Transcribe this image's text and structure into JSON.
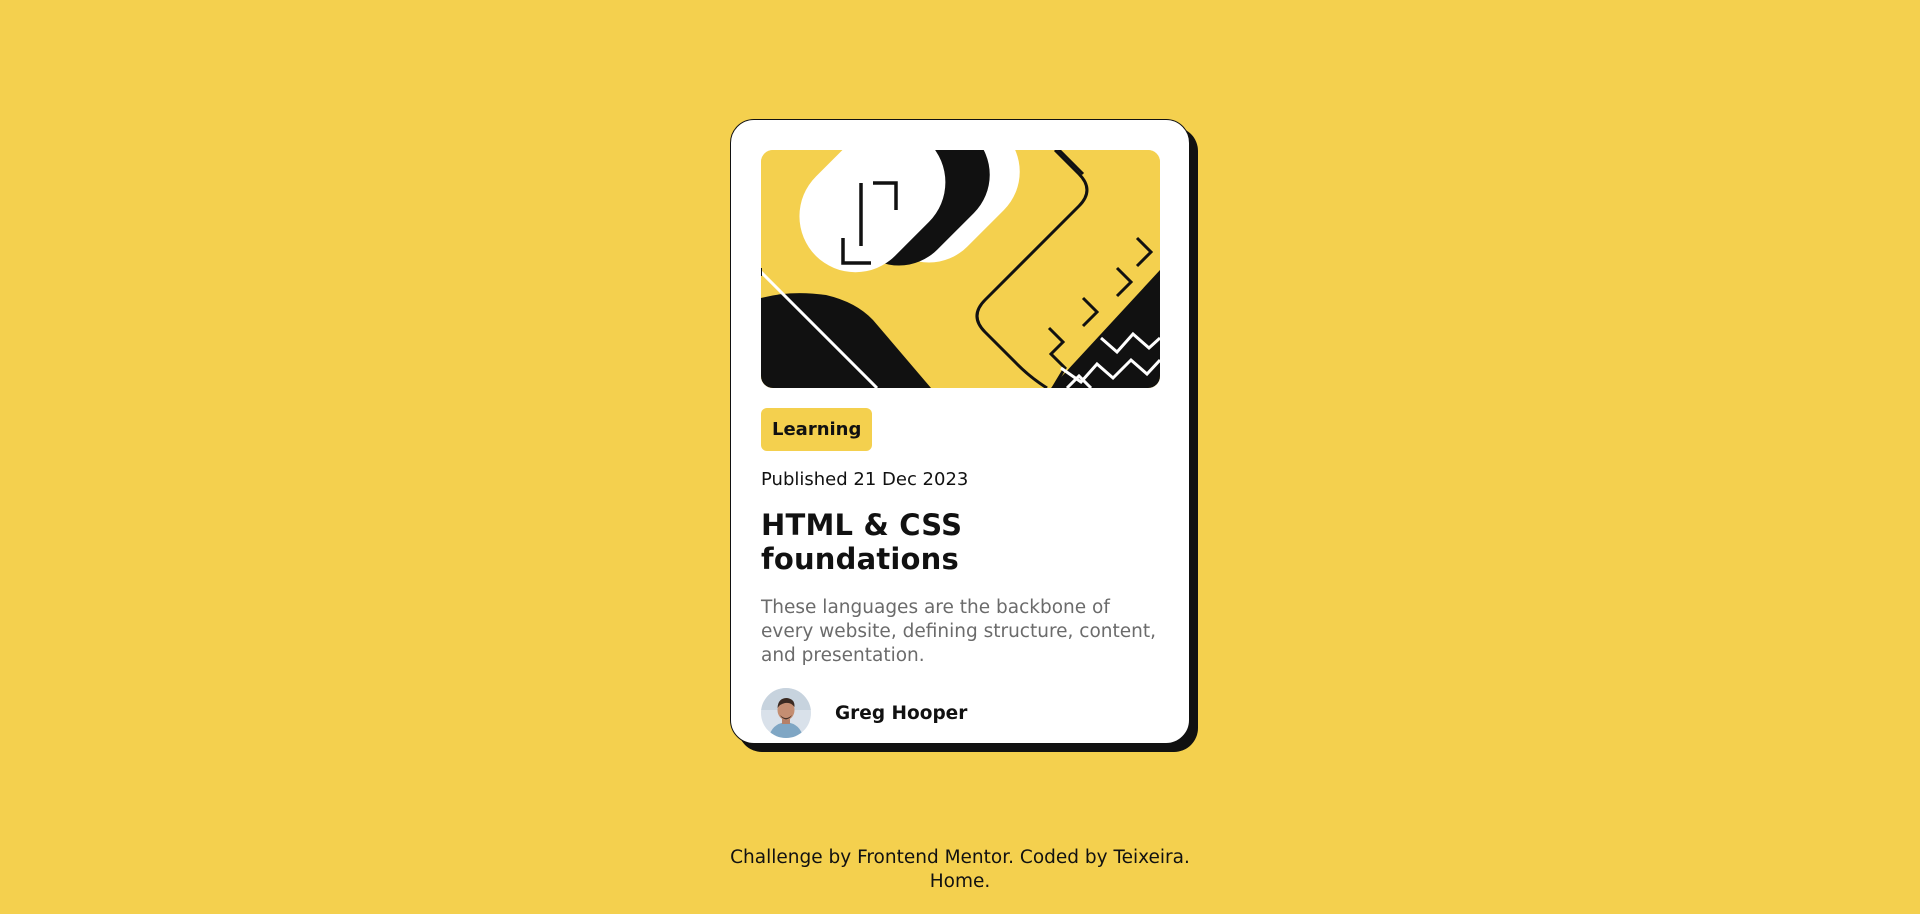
{
  "card": {
    "hero_illustration": "abstract-black-white-shapes-illustration",
    "tag_label": "Learning",
    "published": "Published 21 Dec 2023",
    "title": "HTML & CSS foundations",
    "description": "These languages are the backbone of every website, defining structure, content, and presentation.",
    "author": {
      "name": "Greg Hooper",
      "avatar": "author-avatar-photo"
    }
  },
  "attribution": {
    "prefix": "Challenge by ",
    "frontend_mentor_link": "Frontend Mentor",
    "middle": ". Coded by ",
    "author_link": "Teixeira",
    "suffix": ".",
    "home_link": "Home."
  },
  "colors": {
    "background": "#F4D04E",
    "card": "#FFFFFF",
    "ink": "#111111",
    "muted_text": "#6B6B6B"
  }
}
